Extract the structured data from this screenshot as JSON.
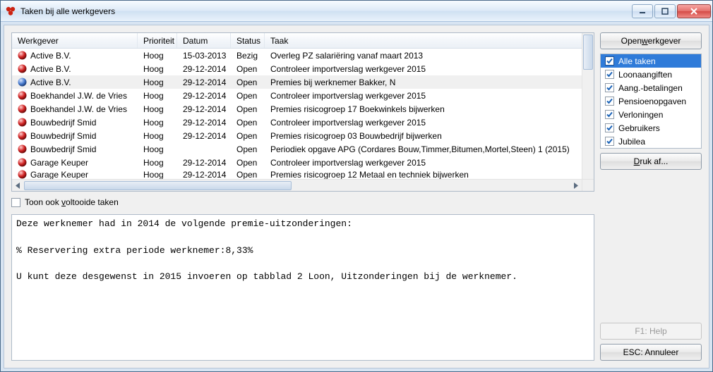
{
  "window": {
    "title": "Taken bij alle werkgevers"
  },
  "columns": {
    "werkgever": "Werkgever",
    "prioriteit": "Prioriteit",
    "datum": "Datum",
    "status": "Status",
    "taak": "Taak"
  },
  "rows": [
    {
      "orb": "red",
      "wg": "Active B.V.",
      "pr": "Hoog",
      "dt": "15-03-2013",
      "st": "Bezig",
      "tk": "Overleg PZ salariëring vanaf maart 2013",
      "sel": false
    },
    {
      "orb": "red",
      "wg": "Active B.V.",
      "pr": "Hoog",
      "dt": "29-12-2014",
      "st": "Open",
      "tk": "Controleer importverslag werkgever 2015",
      "sel": false
    },
    {
      "orb": "blue",
      "wg": "Active B.V.",
      "pr": "Hoog",
      "dt": "29-12-2014",
      "st": "Open",
      "tk": "Premies bij werknemer Bakker, N",
      "sel": true
    },
    {
      "orb": "red",
      "wg": "Boekhandel J.W. de Vries",
      "pr": "Hoog",
      "dt": "29-12-2014",
      "st": "Open",
      "tk": "Controleer importverslag werkgever 2015",
      "sel": false
    },
    {
      "orb": "red",
      "wg": "Boekhandel J.W. de Vries",
      "pr": "Hoog",
      "dt": "29-12-2014",
      "st": "Open",
      "tk": "Premies risicogroep 17 Boekwinkels bijwerken",
      "sel": false
    },
    {
      "orb": "red",
      "wg": "Bouwbedrijf Smid",
      "pr": "Hoog",
      "dt": "29-12-2014",
      "st": "Open",
      "tk": "Controleer importverslag werkgever 2015",
      "sel": false
    },
    {
      "orb": "red",
      "wg": "Bouwbedrijf Smid",
      "pr": "Hoog",
      "dt": "29-12-2014",
      "st": "Open",
      "tk": "Premies risicogroep 03 Bouwbedrijf bijwerken",
      "sel": false
    },
    {
      "orb": "red",
      "wg": "Bouwbedrijf Smid",
      "pr": "Hoog",
      "dt": "",
      "st": "Open",
      "tk": "Periodiek opgave APG (Cordares Bouw,Timmer,Bitumen,Mortel,Steen) 1 (2015)",
      "sel": false
    },
    {
      "orb": "red",
      "wg": "Garage Keuper",
      "pr": "Hoog",
      "dt": "29-12-2014",
      "st": "Open",
      "tk": "Controleer importverslag werkgever 2015",
      "sel": false
    },
    {
      "orb": "red",
      "wg": "Garage Keuper",
      "pr": "Hoog",
      "dt": "29-12-2014",
      "st": "Open",
      "tk": "Premies risicogroep 12 Metaal en techniek bijwerken",
      "sel": false,
      "cut": true
    }
  ],
  "showCompleted": {
    "pre": "Toon ook ",
    "u": "v",
    "post": "oltooide taken",
    "on": false
  },
  "detailText": "Deze werknemer had in 2014 de volgende premie-uitzonderingen:\n\n% Reservering extra periode werknemer:8,33%\n\nU kunt deze desgewenst in 2015 invoeren op tabblad 2 Loon, Uitzonderingen bij de werknemer.",
  "buttons": {
    "open": {
      "pre": "Open ",
      "u": "w",
      "post": "erkgever"
    },
    "print": {
      "pre": "",
      "u": "D",
      "post": "ruk af..."
    },
    "help": "F1: Help",
    "cancel": "ESC: Annuleer"
  },
  "filters": [
    {
      "label": "Alle taken",
      "on": true,
      "sel": true
    },
    {
      "label": "Loonaangiften",
      "on": true,
      "sel": false
    },
    {
      "label": "Aang.-betalingen",
      "on": true,
      "sel": false
    },
    {
      "label": "Pensioenopgaven",
      "on": true,
      "sel": false
    },
    {
      "label": "Verloningen",
      "on": true,
      "sel": false
    },
    {
      "label": "Gebruikers",
      "on": true,
      "sel": false
    },
    {
      "label": "Jubilea",
      "on": true,
      "sel": false
    }
  ]
}
